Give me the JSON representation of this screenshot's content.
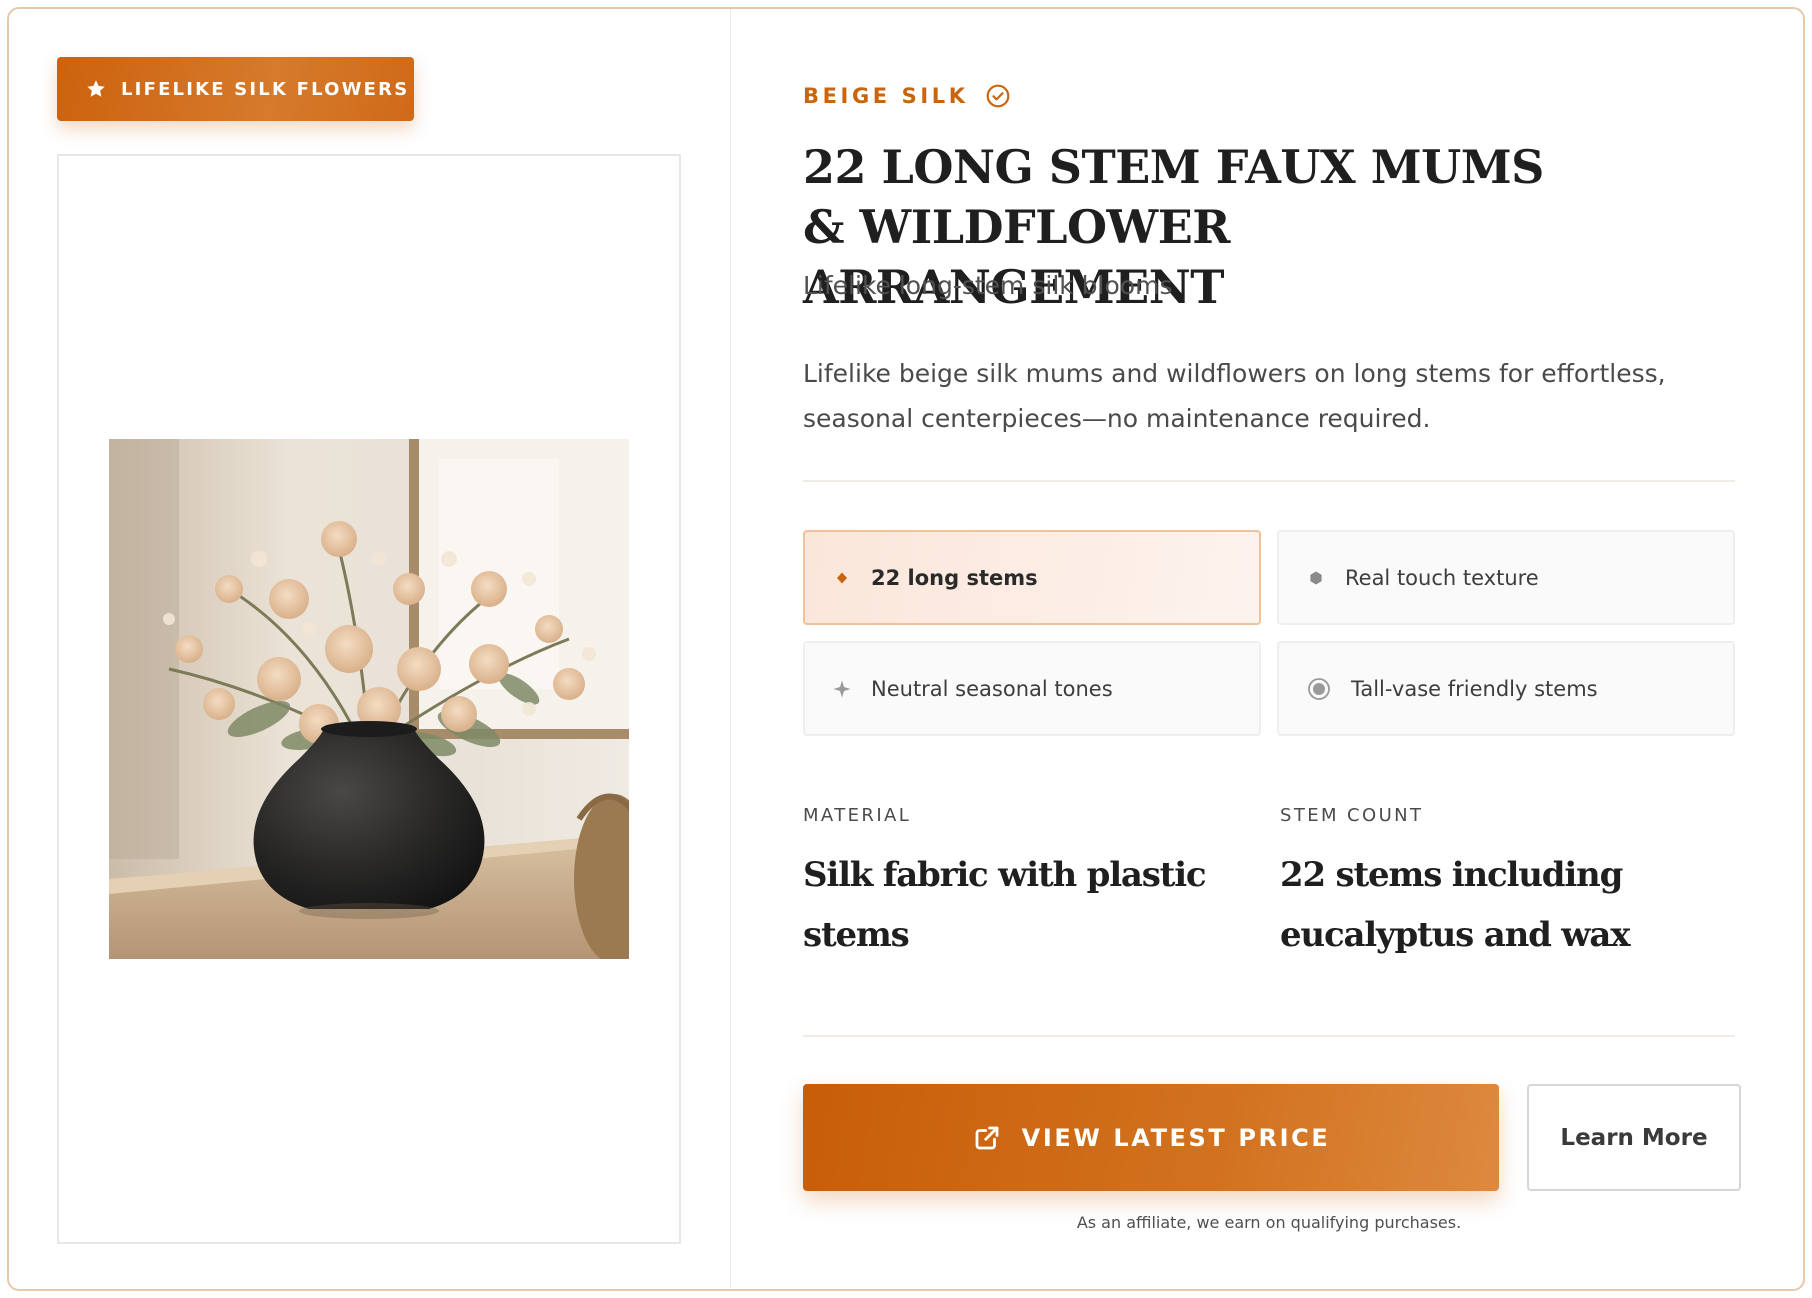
{
  "badge": {
    "label": "LIFELIKE SILK FLOWERS",
    "icon": "star-icon"
  },
  "product_image": {
    "alt": "Beige faux mums and wildflowers in a black textured vase"
  },
  "product": {
    "eyebrow": "BEIGE SILK",
    "eyebrow_icon": "check-circle-icon",
    "title": "22 LONG STEM FAUX MUMS & WILDFLOWER ARRANGEMENT",
    "subtitle": "Lifelike long-stem silk blooms",
    "description": "Lifelike beige silk mums and wildflowers on long stems for effortless, seasonal centerpieces—no maintenance required."
  },
  "features": [
    {
      "label": "22 long stems",
      "icon": "diamond-icon",
      "active": true
    },
    {
      "label": "Real touch texture",
      "icon": "hexagon-icon",
      "active": false
    },
    {
      "label": "Neutral seasonal tones",
      "icon": "sparkle-icon",
      "active": false
    },
    {
      "label": "Tall-vase friendly stems",
      "icon": "radio-dot-icon",
      "active": false
    }
  ],
  "specs": [
    {
      "label": "MATERIAL",
      "value": "Silk fabric with plastic stems"
    },
    {
      "label": "STEM COUNT",
      "value": "22 stems including eucalyptus and wax"
    }
  ],
  "actions": {
    "primary_label": "VIEW LATEST PRICE",
    "primary_icon": "external-link-icon",
    "secondary_label": "Learn More"
  },
  "disclaimer": "As an affiliate, we earn on qualifying purchases.",
  "colors": {
    "accent": "#c8650e",
    "accent_light": "#dd893f",
    "border": "#e6c9ac",
    "text_dark": "#1f1f1f",
    "text_body": "#4a4a4a"
  }
}
